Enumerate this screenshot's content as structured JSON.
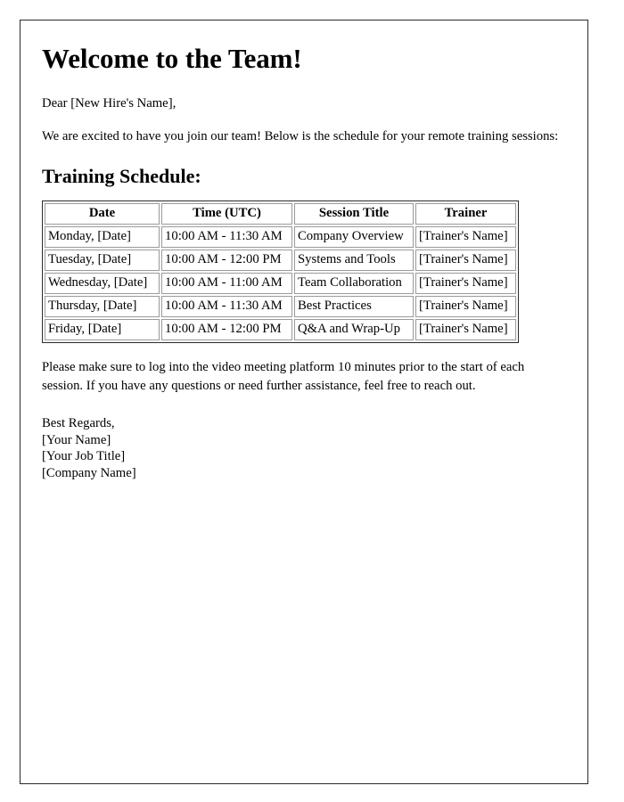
{
  "document": {
    "title": "Welcome to the Team!",
    "salutation": "Dear [New Hire's Name],",
    "intro_paragraph": "We are excited to have you join our team! Below is the schedule for your remote training sessions:",
    "section_heading": "Training Schedule:",
    "closing_paragraph": "Please make sure to log into the video meeting platform 10 minutes prior to the start of each session. If you have any questions or need further assistance, feel free to reach out.",
    "signature": {
      "sign_off": "Best Regards,",
      "name": "[Your Name]",
      "job_title": "[Your Job Title]",
      "company": "[Company Name]"
    }
  },
  "schedule_table": {
    "columns": [
      "Date",
      "Time (UTC)",
      "Session Title",
      "Trainer"
    ],
    "rows": [
      {
        "date": "Monday, [Date]",
        "time": "10:00 AM - 11:30 AM",
        "session": "Company Overview",
        "trainer": "[Trainer's Name]"
      },
      {
        "date": "Tuesday, [Date]",
        "time": "10:00 AM - 12:00 PM",
        "session": "Systems and Tools",
        "trainer": "[Trainer's Name]"
      },
      {
        "date": "Wednesday, [Date]",
        "time": "10:00 AM - 11:00 AM",
        "session": "Team Collaboration",
        "trainer": "[Trainer's Name]"
      },
      {
        "date": "Thursday, [Date]",
        "time": "10:00 AM - 11:30 AM",
        "session": "Best Practices",
        "trainer": "[Trainer's Name]"
      },
      {
        "date": "Friday, [Date]",
        "time": "10:00 AM - 12:00 PM",
        "session": "Q&A and Wrap-Up",
        "trainer": "[Trainer's Name]"
      }
    ]
  },
  "colors": {
    "page_background": "#ffffff",
    "text": "#000000",
    "page_border": "#2b2b2b",
    "table_outer_border": "#2b2b2b",
    "table_cell_border": "#9a9a9a"
  }
}
